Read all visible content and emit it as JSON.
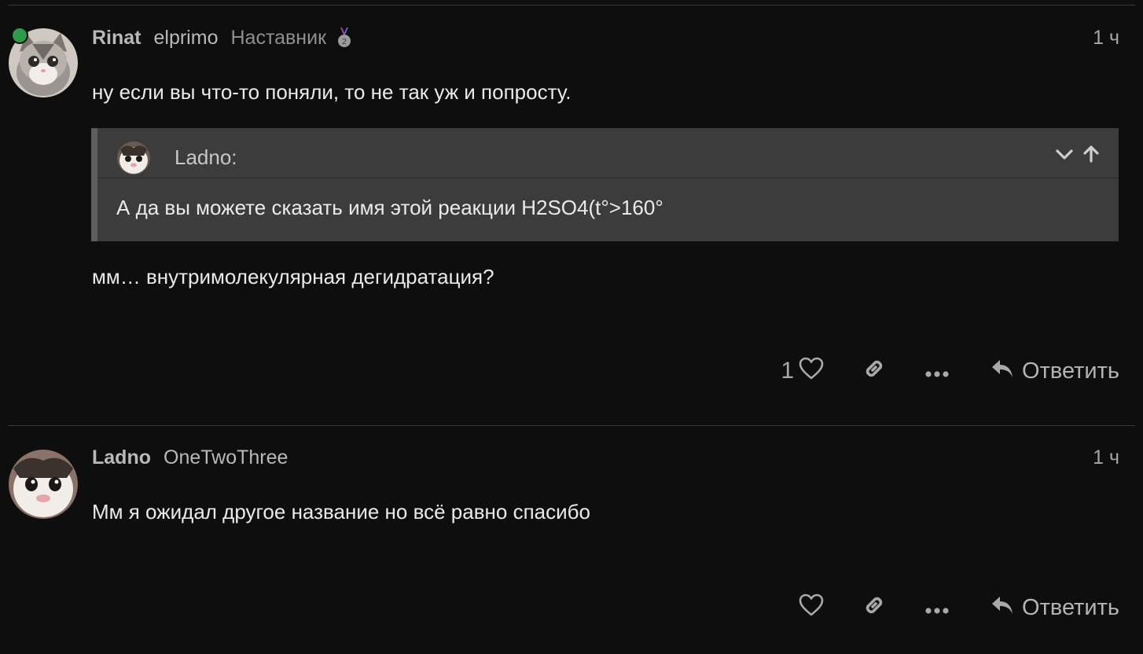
{
  "posts": [
    {
      "username": "Rinat",
      "fullname": "elprimo",
      "title": "Наставник",
      "time": "1 ч",
      "text_before": "ну если вы что-то поняли, то не так уж и попросту.",
      "quote": {
        "author": "Ladno:",
        "text": "А да вы можете сказать имя этой реакции H2SO4(t°>160°"
      },
      "text_after": "мм… внутримолекулярная дегидратация?",
      "like_count": "1",
      "reply_label": "Ответить"
    },
    {
      "username": "Ladno",
      "fullname": "OneTwoThree",
      "time": "1 ч",
      "text": "Мм я ожидал другое название но всё равно спасибо",
      "reply_label": "Ответить"
    }
  ],
  "colors": {
    "background": "#0e0e0e",
    "quote_background": "#3c3c3c",
    "online_indicator": "#2f9a4a",
    "muted_text": "#a9a9a9"
  },
  "icons": {
    "like": "heart-icon",
    "share": "link-icon",
    "more": "ellipsis-icon",
    "reply": "reply-arrow-icon",
    "quote_collapse": "chevron-down-icon",
    "quote_jump": "arrow-up-icon",
    "badge": "medal-icon"
  }
}
